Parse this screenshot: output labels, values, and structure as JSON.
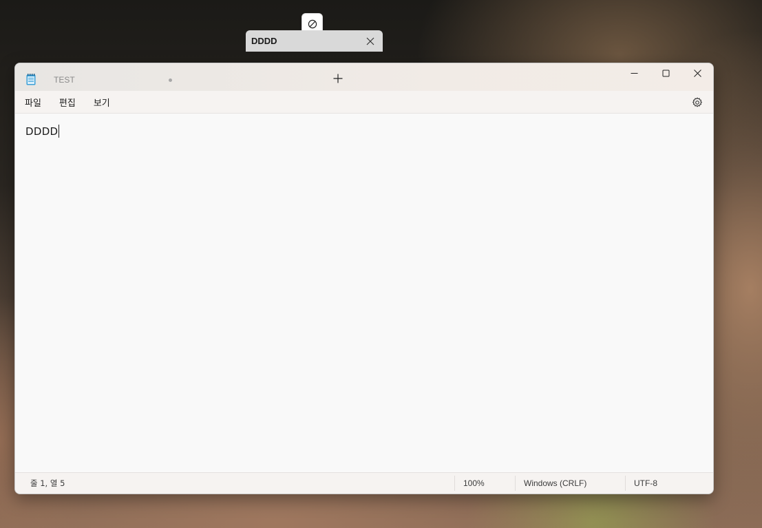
{
  "drag_preview": {
    "tab_title": "DDDD",
    "badge_icon": "no-entry-icon"
  },
  "window": {
    "tabs": [
      {
        "title": "TEST",
        "modified": true
      }
    ],
    "menu": {
      "file": "파일",
      "edit": "편집",
      "view": "보기"
    },
    "editor": {
      "content": "DDDD"
    },
    "status": {
      "position": "줄 1, 열 5",
      "zoom": "100%",
      "line_ending": "Windows (CRLF)",
      "encoding": "UTF-8"
    }
  }
}
